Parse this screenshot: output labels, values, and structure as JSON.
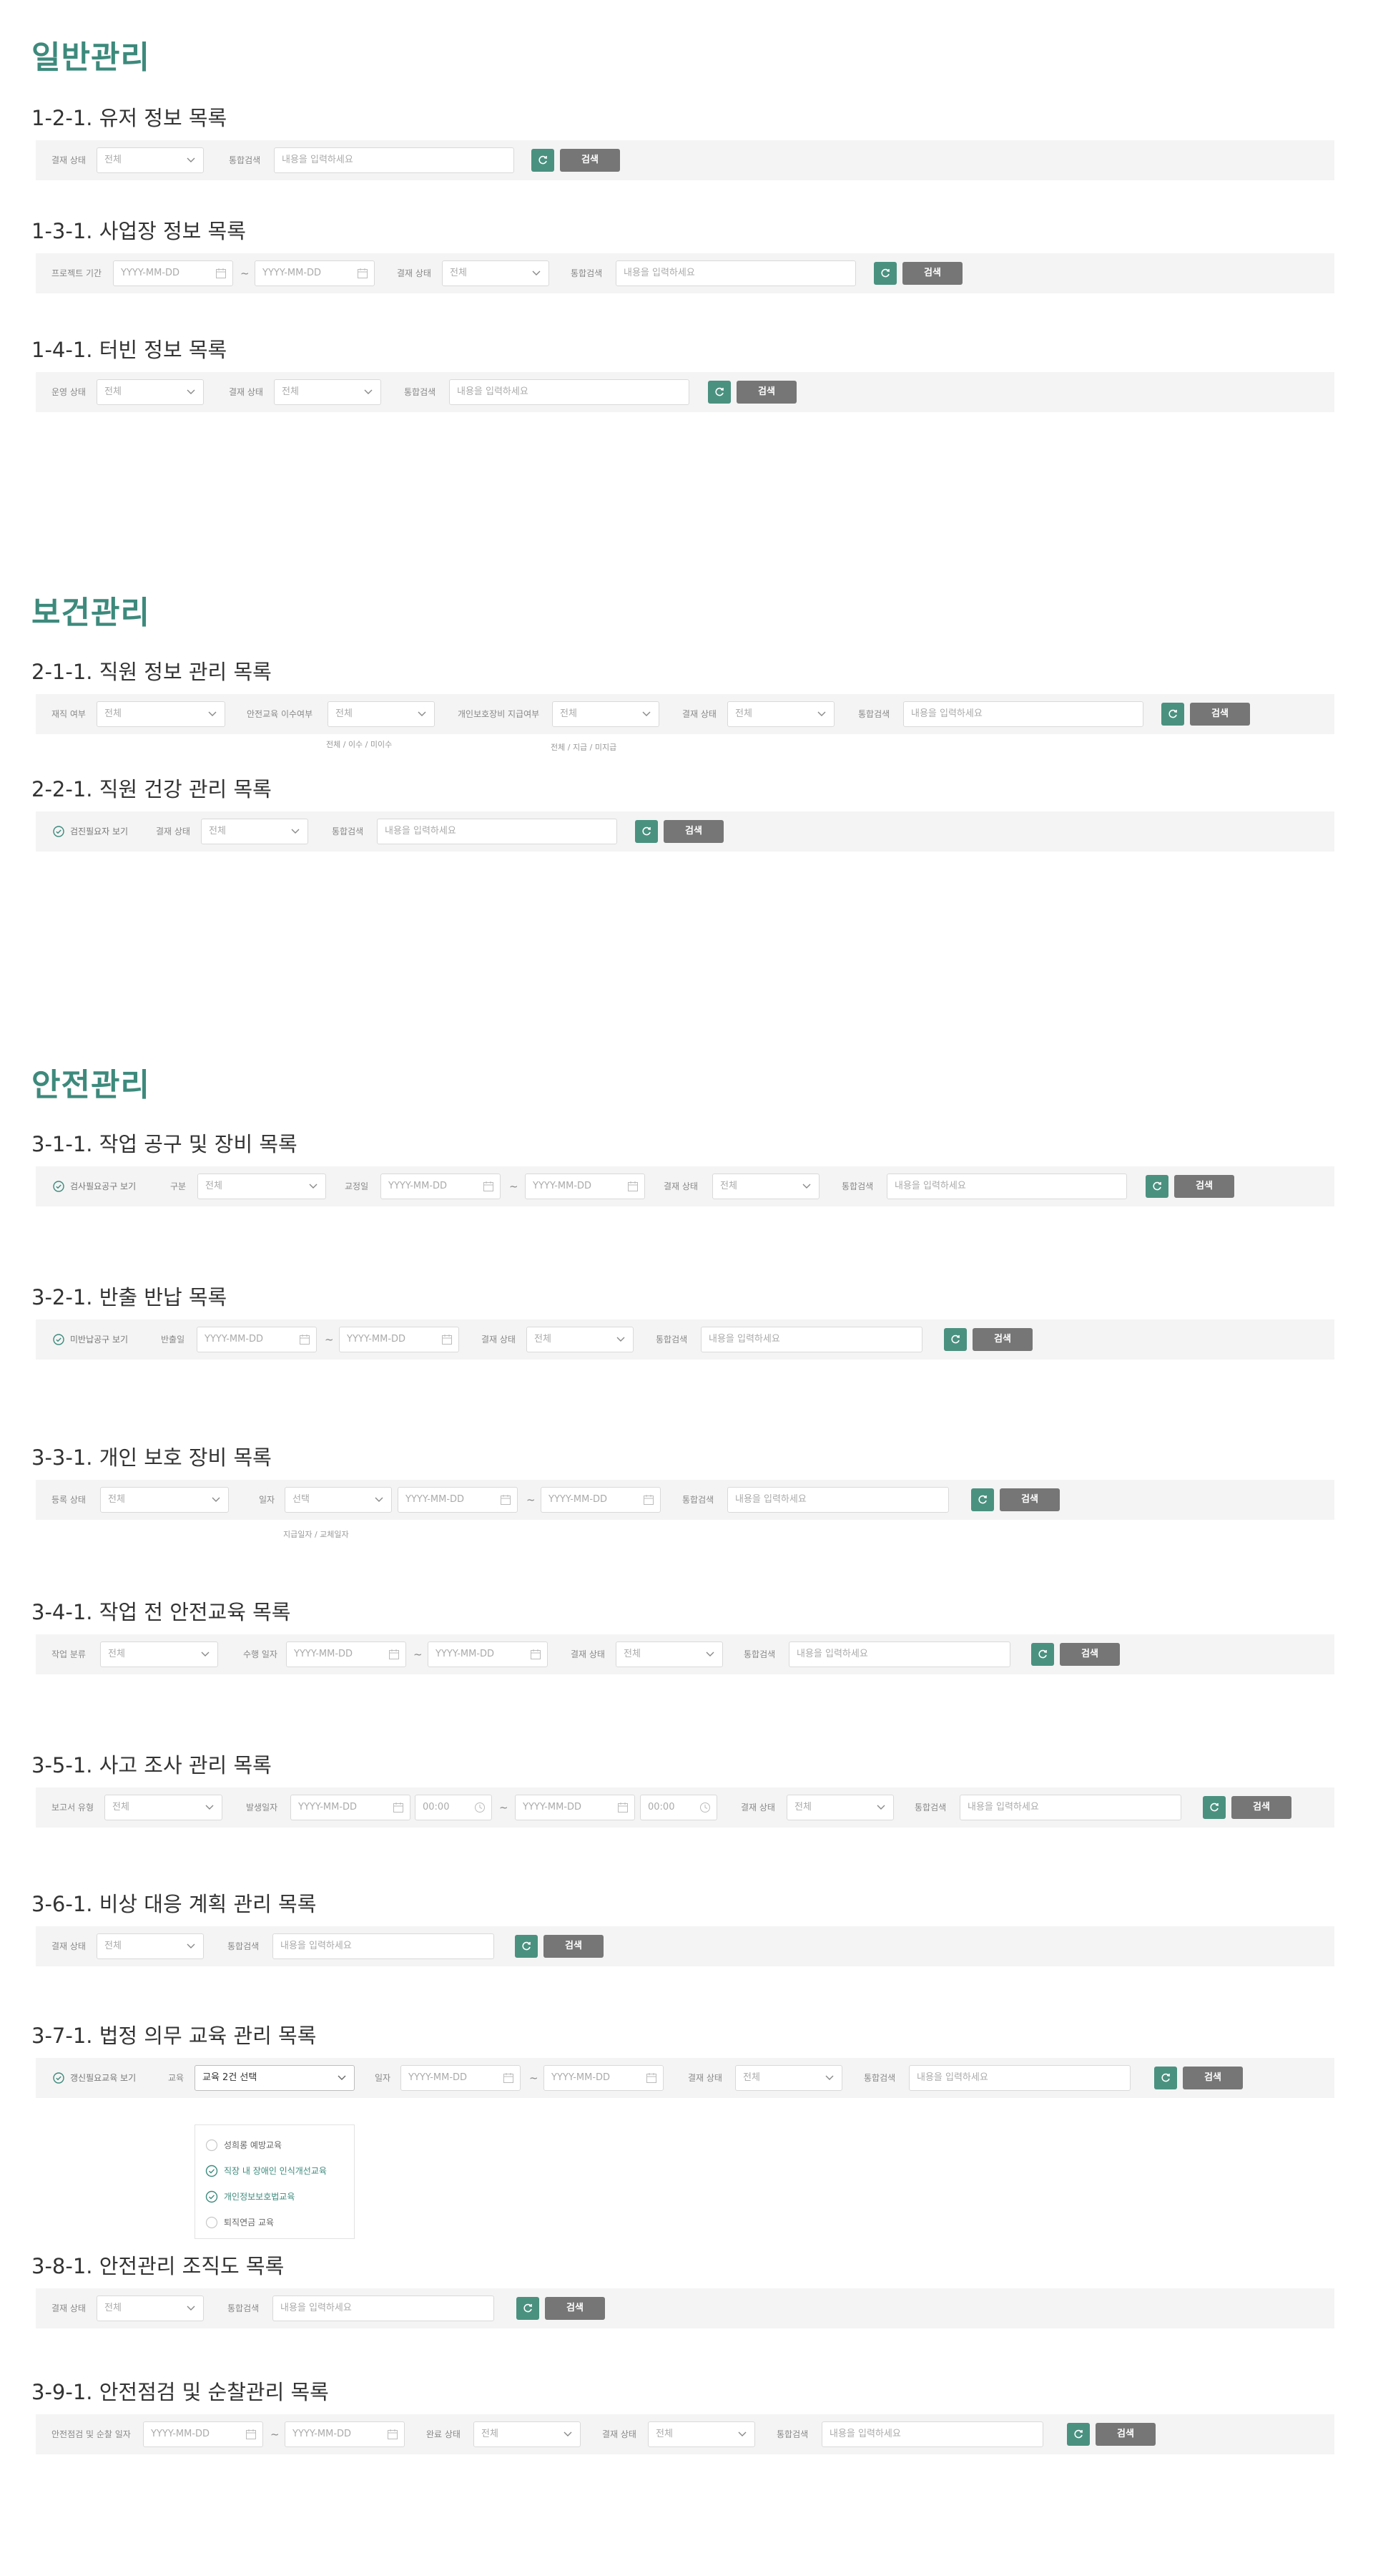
{
  "sections": {
    "general": "일반관리",
    "health": "보건관리",
    "safety": "안전관리"
  },
  "common": {
    "all": "전체",
    "search_placeholder": "내용을 입력하세요",
    "date_placeholder": "YYYY-MM-DD",
    "time_placeholder": "00:00",
    "search_button": "검색",
    "dash": "~"
  },
  "s121": {
    "title": "1-2-1. 유저 정보 목록",
    "approval_status": "결재 상태",
    "total_search": "통합검색"
  },
  "s131": {
    "title": "1-3-1. 사업장 정보 목록",
    "project_period": "프로젝트 기간",
    "approval_status": "결재 상태",
    "total_search": "통합검색"
  },
  "s141": {
    "title": "1-4-1. 터빈 정보 목록",
    "operation_status": "운영 상태",
    "approval_status": "결재 상태",
    "total_search": "통합검색"
  },
  "s211": {
    "title": "2-1-1. 직원 정보 관리 목록",
    "employment": "재직 여부",
    "safety_edu": "안전교육 이수여부",
    "safety_edu_hint": "전체 / 이수 / 미이수",
    "ppe_supply": "개인보호장비 지급여부",
    "ppe_supply_hint": "전체 / 지급 / 미지급",
    "approval_status": "결재 상태",
    "total_search": "통합검색"
  },
  "s221": {
    "title": "2-2-1. 직원 건강 관리 목록",
    "check": "검진필요자 보기",
    "approval_status": "결재 상태",
    "total_search": "통합검색"
  },
  "s311": {
    "title": "3-1-1. 작업 공구 및 장비 목록",
    "check": "검사필요공구 보기",
    "category": "구분",
    "inspection_date": "교정일",
    "approval_status": "결재 상태",
    "total_search": "통합검색"
  },
  "s321": {
    "title": "3-2-1. 반출 반납 목록",
    "check": "미반납공구 보기",
    "export_date": "반출일",
    "approval_status": "결재 상태",
    "total_search": "통합검색"
  },
  "s331": {
    "title": "3-3-1. 개인 보호 장비 목록",
    "reg_status": "등록 상태",
    "date": "일자",
    "select": "선택",
    "date_hint": "지급일자 / 교체일자",
    "total_search": "통합검색"
  },
  "s341": {
    "title": "3-4-1. 작업 전 안전교육 목록",
    "work_type": "작업 분류",
    "exec_date": "수행 일자",
    "approval_status": "결재 상태",
    "total_search": "통합검색"
  },
  "s351": {
    "title": "3-5-1. 사고 조사 관리 목록",
    "report_type": "보고서 유형",
    "occur_date": "발생일자",
    "approval_status": "결재 상태",
    "total_search": "통합검색"
  },
  "s361": {
    "title": "3-6-1. 비상 대응 계획 관리 목록",
    "approval_status": "결재 상태",
    "total_search": "통합검색"
  },
  "s371": {
    "title": "3-7-1. 법정 의무 교육 관리 목록",
    "check": "갱신필요교육 보기",
    "edu": "교육",
    "edu_selected": "교육 2건 선택",
    "date": "일자",
    "approval_status": "결재 상태",
    "total_search": "통합검색",
    "options": [
      {
        "label": "성희롱 예방교육",
        "checked": false
      },
      {
        "label": "직장 내 장애인 인식개선교육",
        "checked": true
      },
      {
        "label": "개인정보보호법교육",
        "checked": true
      },
      {
        "label": "퇴직연금 교육",
        "checked": false
      }
    ]
  },
  "s381": {
    "title": "3-8-1. 안전관리 조직도 목록",
    "approval_status": "결재 상태",
    "total_search": "통합검색"
  },
  "s391": {
    "title": "3-9-1. 안전점검 및 순찰관리 목록",
    "patrol_date": "안전점검 및 순찰 일자",
    "done_status": "완료 상태",
    "approval_status": "결재 상태",
    "total_search": "통합검색"
  },
  "colors": {
    "accent": "#3d8a7c",
    "refresh": "#4a9180",
    "search_button": "#767676",
    "bar": "#f4f4f4"
  },
  "icons": [
    "chevron-down-icon",
    "calendar-icon",
    "clock-icon",
    "refresh-icon",
    "check-circle-icon"
  ]
}
